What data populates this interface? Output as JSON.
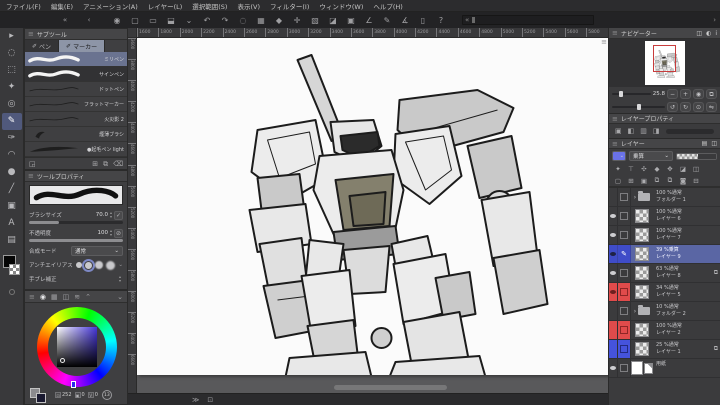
{
  "menu_bar": {
    "items": [
      "ファイル(F)",
      "編集(E)",
      "アニメーション(A)",
      "レイヤー(L)",
      "選択範囲(S)",
      "表示(V)",
      "フィルター(I)",
      "ウィンドウ(W)",
      "ヘルプ(H)"
    ]
  },
  "command_bar": {
    "back_icons": [
      {
        "g": "«",
        "n": "collapse-left-icon"
      },
      {
        "g": "‹",
        "n": "scroll-left-icon"
      }
    ],
    "icons": [
      {
        "g": "◉",
        "n": "workspace-icon"
      },
      {
        "g": "▢",
        "n": "new-canvas-icon"
      },
      {
        "g": "▭",
        "n": "open-file-icon"
      },
      {
        "g": "⬓",
        "n": "save-icon"
      },
      {
        "g": "⌄",
        "n": "save-menu-icon"
      },
      {
        "g": "↶",
        "n": "undo-icon"
      },
      {
        "g": "↷",
        "n": "redo-icon"
      },
      {
        "g": "◌",
        "n": "deselect-icon"
      },
      {
        "g": "▦",
        "n": "reselect-icon"
      },
      {
        "g": "◆",
        "n": "fill-icon"
      },
      {
        "g": "✛",
        "n": "move-icon"
      },
      {
        "g": "▧",
        "n": "snap-ruler-icon"
      },
      {
        "g": "◪",
        "n": "snap-special-ruler-icon"
      },
      {
        "g": "▣",
        "n": "snap-grid-icon"
      },
      {
        "g": "∠",
        "n": "rotate-canvas-icon"
      },
      {
        "g": "✎",
        "n": "modify-brush-icon"
      },
      {
        "g": "∡",
        "n": "flip-view-icon"
      },
      {
        "g": "▯",
        "n": "companion-mode-icon"
      },
      {
        "g": "?",
        "n": "help-icon"
      }
    ],
    "materials_collapse": "«",
    "materials_next": "›"
  },
  "tool_strip": {
    "tools": [
      {
        "g": "▸",
        "n": "operation-tool"
      },
      {
        "g": "◌",
        "n": "lasso-tool"
      },
      {
        "g": "⬚",
        "n": "marquee-tool"
      },
      {
        "g": "✦",
        "n": "auto-select-tool"
      },
      {
        "g": "◎",
        "n": "eyedropper-tool"
      },
      {
        "g": "✎",
        "n": "pen-tool",
        "sel": true
      },
      {
        "g": "✑",
        "n": "brush-tool"
      },
      {
        "g": "◠",
        "n": "figure-tool"
      },
      {
        "g": "●",
        "n": "blend-tool"
      },
      {
        "g": "╱",
        "n": "ruler-tool"
      },
      {
        "g": "▣",
        "n": "frame-border-tool"
      },
      {
        "g": "A",
        "n": "text-tool"
      },
      {
        "g": "▤",
        "n": "gradient-tool"
      }
    ],
    "foreground_color": "#000000"
  },
  "subtool_panel": {
    "title": "サブツール",
    "tabs": [
      {
        "label": "ペン",
        "sel": false
      },
      {
        "label": "マーカー",
        "sel": true
      }
    ],
    "brushes": [
      {
        "name": "ミリペン",
        "sel": true,
        "white": true,
        "wave": true
      },
      {
        "name": "サインペン",
        "white": true,
        "wave": true
      },
      {
        "name": "ドットペン",
        "thin": true
      },
      {
        "name": "フラットマーカー",
        "thin": true
      },
      {
        "name": "火災影 2",
        "thin": true
      },
      {
        "name": "煙薄ブラシ",
        "blob": true
      },
      {
        "name": "●起毛ペン light",
        "taper": true
      }
    ],
    "footer_left": {
      "g": "◲",
      "n": "register-initial-settings-icon"
    },
    "footer_icons": [
      {
        "g": "⊞",
        "n": "add-subtool-icon"
      },
      {
        "g": "⧉",
        "n": "duplicate-subtool-icon"
      },
      {
        "g": "⌫",
        "n": "delete-subtool-icon"
      }
    ]
  },
  "tool_property": {
    "title": "ツールプロパティ",
    "size_label": "ブラシサイズ",
    "size_value": "70.0",
    "opacity_label": "不透明度",
    "opacity_value": "100",
    "blend_label": "合成モード",
    "blend_value": "通常",
    "aa_label": "アンチエイリアス",
    "stabilize_label": "手ブレ補正",
    "footer_icons": [
      {
        "g": "↺",
        "n": "reset-all-settings-icon"
      },
      {
        "g": "⊙",
        "n": "subtool-detail-icon"
      }
    ]
  },
  "color_panel": {
    "tabs": [
      {
        "g": "◉",
        "n": "color-wheel-tab",
        "sel": true
      },
      {
        "g": "▦",
        "n": "color-set-tab"
      },
      {
        "g": "◫",
        "n": "color-slider-tab"
      },
      {
        "g": "≋",
        "n": "approximate-color-tab"
      },
      {
        "g": "⌃",
        "n": "history-tab"
      }
    ],
    "collapse": "⌄",
    "hue": "252",
    "sat": "0",
    "val": "0",
    "val_label": "V",
    "badge": "13"
  },
  "navigator": {
    "title": "ナビゲーター",
    "header_icons": [
      {
        "g": "◫",
        "n": "subview-tab-icon"
      },
      {
        "g": "◐",
        "n": "item-bank-tab-icon"
      },
      {
        "g": "i",
        "n": "information-icon"
      }
    ],
    "zoom_value": "25.8",
    "zoom_buttons": [
      {
        "g": "−",
        "n": "zoom-out-button"
      },
      {
        "g": "+",
        "n": "zoom-in-button"
      },
      {
        "g": "◉",
        "n": "fit-to-window-button"
      },
      {
        "g": "⧉",
        "n": "subview-button"
      }
    ],
    "rotate_buttons": [
      {
        "g": "↺",
        "n": "rotate-left-button"
      },
      {
        "g": "↻",
        "n": "rotate-right-button"
      },
      {
        "g": "⊙",
        "n": "reset-rotation-button"
      },
      {
        "g": "⇋",
        "n": "flip-horizontal-button"
      }
    ]
  },
  "layer_property": {
    "title": "レイヤープロパティ",
    "effect_icons": [
      {
        "g": "▣",
        "n": "border-effect-icon"
      },
      {
        "g": "◧",
        "n": "tone-effect-icon"
      },
      {
        "g": "▥",
        "n": "layer-color-icon"
      },
      {
        "g": "◨",
        "n": "expression-color-icon"
      }
    ]
  },
  "layers_panel": {
    "title": "レイヤー",
    "tab_icons": [
      {
        "g": "▤",
        "n": "layer-search-tab-icon"
      },
      {
        "g": "◫",
        "n": "timeline-tab-icon"
      }
    ],
    "blend_value": "乗算",
    "icons_row1": [
      {
        "g": "✦",
        "n": "clip-below-layer-icon"
      },
      {
        "g": "⊤",
        "n": "reference-layer-icon"
      },
      {
        "g": "✣",
        "n": "draft-layer-icon"
      },
      {
        "g": "◆",
        "n": "lock-layer-icon"
      },
      {
        "g": "✥",
        "n": "lock-transparent-pixels-icon"
      },
      {
        "g": "◪",
        "n": "enable-mask-icon"
      },
      {
        "g": "◫",
        "n": "link-ruler-icon"
      }
    ],
    "icons_row2": [
      {
        "g": "▢",
        "n": "new-raster-layer-icon"
      },
      {
        "g": "⊞",
        "n": "new-vector-layer-icon"
      },
      {
        "g": "▣",
        "n": "new-folder-icon"
      },
      {
        "g": "⧉",
        "n": "transfer-to-lower-icon"
      },
      {
        "g": "⧉",
        "n": "merge-to-lower-icon"
      },
      {
        "g": "◙",
        "n": "create-mask-icon"
      },
      {
        "g": "⊟",
        "n": "delete-layer-icon"
      }
    ],
    "rows": [
      {
        "blend": "100 %通常",
        "name": "フォルダー 1",
        "folder": true
      },
      {
        "blend": "100 %通常",
        "name": "レイヤー 6",
        "eye": true
      },
      {
        "blend": "100 %通常",
        "name": "レイヤー 7",
        "eye": true
      },
      {
        "blend": "39 %乗算",
        "name": "レイヤー 9",
        "eye": true,
        "selected": true,
        "editing": true
      },
      {
        "blend": "63 %通常",
        "name": "レイヤー 8",
        "eye": true,
        "clip": true
      },
      {
        "blend": "34 %通常",
        "name": "レイヤー 5",
        "eye": true,
        "red": true
      },
      {
        "blend": "10 %通常",
        "name": "フォルダー 2",
        "folder": true
      },
      {
        "blend": "100 %通常",
        "name": "レイヤー 2",
        "red": true
      },
      {
        "blend": "25 %通常",
        "name": "レイヤー 1",
        "blue": true,
        "clip": true
      },
      {
        "blend": "",
        "name": "用紙",
        "eye": true,
        "paper": true
      }
    ]
  },
  "canvas": {
    "h_ruler": [
      "1600",
      "1800",
      "2000",
      "2200",
      "2400",
      "2600",
      "2800",
      "3000",
      "3200",
      "3400",
      "3600",
      "3800",
      "4000",
      "4200",
      "4400",
      "4600",
      "4800",
      "5000",
      "5200",
      "5400",
      "5600",
      "5800"
    ],
    "v_ruler": [
      "3600",
      "3800",
      "4000",
      "4200",
      "4400",
      "4600",
      "4800",
      "5000",
      "5200",
      "5400",
      "5600",
      "5800",
      "6000",
      "6200",
      "6400",
      "6600"
    ],
    "divider_handle": "≡"
  },
  "bottom_bar": {
    "icons": [
      {
        "g": "≫",
        "n": "expand-palette-icon"
      },
      {
        "g": "⊡",
        "n": "selection-launcher-icon"
      }
    ]
  }
}
